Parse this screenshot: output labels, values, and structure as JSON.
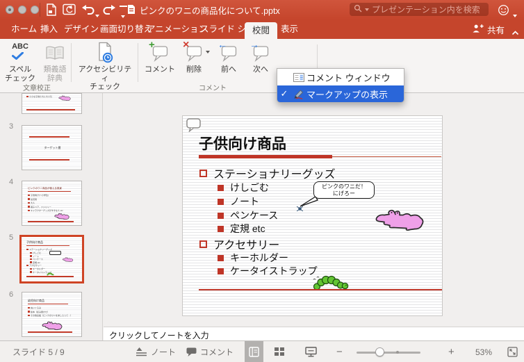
{
  "window": {
    "filename": "ピンクのワニの商品化について.pptx",
    "search_placeholder": "プレゼンテーション内を検索"
  },
  "tabs": [
    {
      "label": "ホーム"
    },
    {
      "label": "挿入"
    },
    {
      "label": "デザイン"
    },
    {
      "label": "画面切り替え"
    },
    {
      "label": "アニメーション"
    },
    {
      "label": "スライド ショー"
    },
    {
      "label": "校閲",
      "active": true
    },
    {
      "label": "表示"
    }
  ],
  "share_label": "共有",
  "ribbon": {
    "spell": {
      "l1": "スペル",
      "l2": "チェック"
    },
    "thesaurus": {
      "l1": "類義語",
      "l2": "辞典"
    },
    "accessibility": {
      "l1": "アクセシビリティ",
      "l2": "チェック"
    },
    "comment_label": "コメント",
    "delete_label": "削除",
    "prev_label": "前へ",
    "next_label": "次へ",
    "group_proofing": "文章校正",
    "group_comments": "コメント"
  },
  "menu": {
    "item1": "コメント ウィンドウ",
    "item2": "マークアップの表示",
    "check_glyph": "✓",
    "highlight_color": "#2a66d9"
  },
  "sidebar": {
    "s2_text": "小さな子供たちに大人気",
    "s3_num": "3",
    "s3_title": "ターゲット層",
    "s4_num": "4",
    "s4_title": "ピンクのワニ商品が使える風景",
    "s4_b1": "子供向け(〜小学生)",
    "s4_b2": "幼児用",
    "s4_b3": "大人",
    "s4_b4": "親子ペア、ファミリー",
    "s4_b5": "キャラクターグッズがすきな人 etc",
    "s5_num": "5",
    "s5_title": "子供向け商品",
    "s5_b1": "ステーショナリーグッズ",
    "s5_b2": "けしごむ",
    "s5_b3": "ノート",
    "s5_b4": "ペンケース",
    "s5_b5": "定規 etc",
    "s5_b6": "アクセサリー",
    "s5_b7": "キーホルダー",
    "s5_b8": "ケータイストラップ",
    "s6_num": "6",
    "s6_title": "幼児向け商品",
    "s6_b1": "ぬいぐるみ",
    "s6_b2": "絵本（読み聞かせ）",
    "s6_b3": "その他全般（ピンクのワニをあしらって…）"
  },
  "slide": {
    "title": "子供向け商品",
    "bullets": [
      {
        "level": 1,
        "text": "ステーショナリーグッズ"
      },
      {
        "level": 2,
        "text": "けしごむ"
      },
      {
        "level": 2,
        "text": "ノート"
      },
      {
        "level": 2,
        "text": "ペンケース"
      },
      {
        "level": 2,
        "text": "定規 etc"
      },
      {
        "level": 1,
        "text": "アクセサリー"
      },
      {
        "level": 2,
        "text": "キーホルダー"
      },
      {
        "level": 2,
        "text": "ケータイストラップ"
      }
    ],
    "speech_line1": "ピンクのワニだ！",
    "speech_line2": "にげろー"
  },
  "notes": {
    "placeholder": "クリックしてノートを入力"
  },
  "statusbar": {
    "slide_indicator": "スライド 5 / 9",
    "notes_label": "ノート",
    "comments_label": "コメント",
    "zoom_level": "53%"
  },
  "colors": {
    "titlebar_red": "#c5452c",
    "menu_highlight_blue": "#2a66d9",
    "slide_accent_red": "#bf3527",
    "croc_pink": "#efa0e8",
    "worm_green": "#62c532"
  }
}
